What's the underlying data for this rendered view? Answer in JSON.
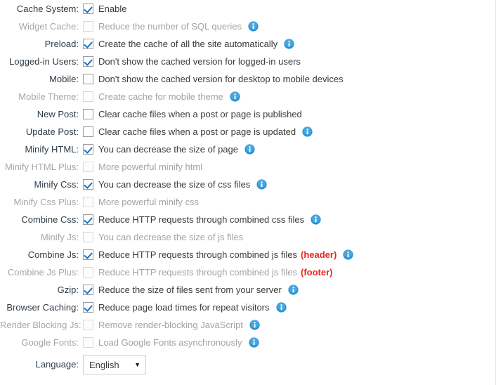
{
  "form": {
    "language_select": {
      "label": "Language:",
      "value": "English",
      "caret": "chevron-down-icon"
    },
    "rows": [
      {
        "label": "Cache System:",
        "option": "Enable",
        "checked": true,
        "disabled": false,
        "info": false,
        "tag": ""
      },
      {
        "label": "Widget Cache:",
        "option": "Reduce the number of SQL queries",
        "checked": false,
        "disabled": true,
        "info": true,
        "tag": ""
      },
      {
        "label": "Preload:",
        "option": "Create the cache of all the site automatically",
        "checked": true,
        "disabled": false,
        "info": true,
        "tag": ""
      },
      {
        "label": "Logged-in Users:",
        "option": "Don't show the cached version for logged-in users",
        "checked": true,
        "disabled": false,
        "info": false,
        "tag": ""
      },
      {
        "label": "Mobile:",
        "option": "Don't show the cached version for desktop to mobile devices",
        "checked": false,
        "disabled": false,
        "info": false,
        "tag": ""
      },
      {
        "label": "Mobile Theme:",
        "option": "Create cache for mobile theme",
        "checked": false,
        "disabled": true,
        "info": true,
        "tag": ""
      },
      {
        "label": "New Post:",
        "option": "Clear cache files when a post or page is published",
        "checked": false,
        "disabled": false,
        "info": false,
        "tag": ""
      },
      {
        "label": "Update Post:",
        "option": "Clear cache files when a post or page is updated",
        "checked": false,
        "disabled": false,
        "info": true,
        "tag": ""
      },
      {
        "label": "Minify HTML:",
        "option": "You can decrease the size of page",
        "checked": true,
        "disabled": false,
        "info": true,
        "tag": ""
      },
      {
        "label": "Minify HTML Plus:",
        "option": "More powerful minify html",
        "checked": false,
        "disabled": true,
        "info": false,
        "tag": ""
      },
      {
        "label": "Minify Css:",
        "option": "You can decrease the size of css files",
        "checked": true,
        "disabled": false,
        "info": true,
        "tag": ""
      },
      {
        "label": "Minify Css Plus:",
        "option": "More powerful minify css",
        "checked": false,
        "disabled": true,
        "info": false,
        "tag": ""
      },
      {
        "label": "Combine Css:",
        "option": "Reduce HTTP requests through combined css files",
        "checked": true,
        "disabled": false,
        "info": true,
        "tag": ""
      },
      {
        "label": "Minify Js:",
        "option": "You can decrease the size of js files",
        "checked": false,
        "disabled": true,
        "info": false,
        "tag": ""
      },
      {
        "label": "Combine Js:",
        "option": "Reduce HTTP requests through combined js files",
        "checked": true,
        "disabled": false,
        "info": true,
        "tag": "(header)"
      },
      {
        "label": "Combine Js Plus:",
        "option": "Reduce HTTP requests through combined js files",
        "checked": false,
        "disabled": true,
        "info": false,
        "tag": "(footer)"
      },
      {
        "label": "Gzip:",
        "option": "Reduce the size of files sent from your server",
        "checked": true,
        "disabled": false,
        "info": true,
        "tag": ""
      },
      {
        "label": "Browser Caching:",
        "option": "Reduce page load times for repeat visitors",
        "checked": true,
        "disabled": false,
        "info": true,
        "tag": ""
      },
      {
        "label": "Render Blocking Js:",
        "option": "Remove render-blocking JavaScript",
        "checked": false,
        "disabled": true,
        "info": true,
        "tag": ""
      },
      {
        "label": "Google Fonts:",
        "option": "Load Google Fonts asynchronously",
        "checked": false,
        "disabled": true,
        "info": true,
        "tag": ""
      }
    ]
  },
  "colors": {
    "check_blue": "#1573c6",
    "info_blue": "#2a93d5",
    "tag_red": "#e8251b",
    "label_enabled": "#2f3b46",
    "label_disabled": "#a6a6a6"
  }
}
